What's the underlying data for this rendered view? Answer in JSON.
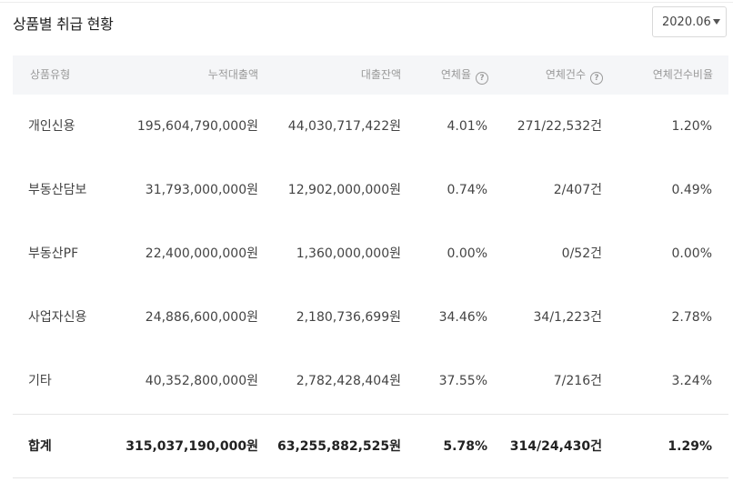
{
  "title": "상품별 취급 현황",
  "month_select": {
    "value": "2020.06"
  },
  "columns": [
    "상품유형",
    "누적대출액",
    "대출잔액",
    "연체율",
    "연체건수",
    "연체건수비율"
  ],
  "rows": [
    [
      "개인신용",
      "195,604,790,000원",
      "44,030,717,422원",
      "4.01%",
      "271/22,532건",
      "1.20%"
    ],
    [
      "부동산담보",
      "31,793,000,000원",
      "12,902,000,000원",
      "0.74%",
      "2/407건",
      "0.49%"
    ],
    [
      "부동산PF",
      "22,400,000,000원",
      "1,360,000,000원",
      "0.00%",
      "0/52건",
      "0.00%"
    ],
    [
      "사업자신용",
      "24,886,600,000원",
      "2,180,736,699원",
      "34.46%",
      "34/1,223건",
      "2.78%"
    ],
    [
      "기타",
      "40,352,800,000원",
      "2,782,428,404원",
      "37.55%",
      "7/216건",
      "3.24%"
    ]
  ],
  "total": [
    "합계",
    "315,037,190,000원",
    "63,255,882,525원",
    "5.78%",
    "314/24,430건",
    "1.29%"
  ],
  "help_icon_glyph": "?"
}
